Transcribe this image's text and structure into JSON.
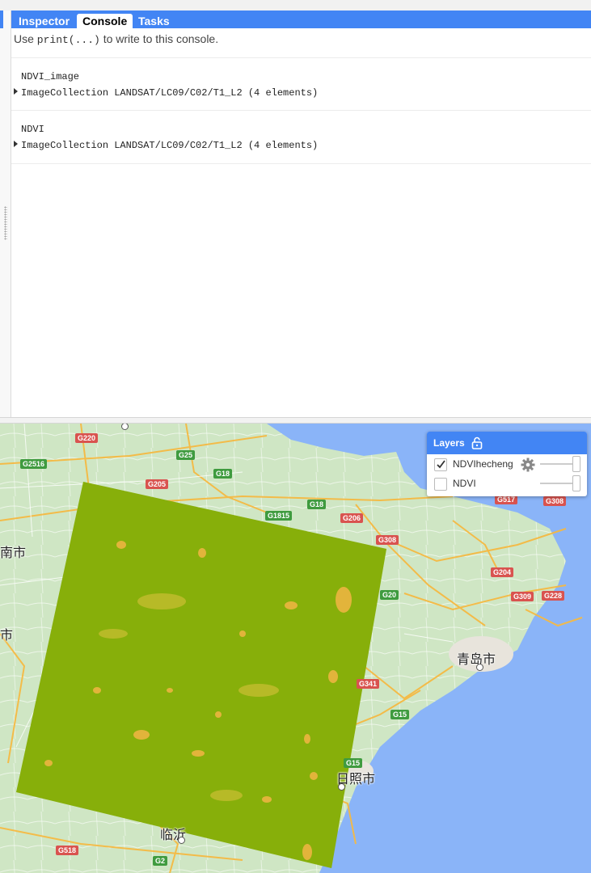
{
  "tabs": [
    {
      "label": "Inspector"
    },
    {
      "label": "Console"
    },
    {
      "label": "Tasks"
    }
  ],
  "console": {
    "hint_pre": "Use ",
    "hint_code": "print(...)",
    "hint_post": " to write to this console.",
    "entries": [
      {
        "title": "NDVI_image",
        "value": "ImageCollection LANDSAT/LC09/C02/T1_L2 (4 elements)"
      },
      {
        "title": "NDVI",
        "value": "ImageCollection LANDSAT/LC09/C02/T1_L2 (4 elements)"
      }
    ]
  },
  "map": {
    "shields": [
      {
        "text": "G220",
        "color": "red"
      },
      {
        "text": "G25",
        "color": "green"
      },
      {
        "text": "G2516",
        "color": "green"
      },
      {
        "text": "G18",
        "color": "green"
      },
      {
        "text": "G205",
        "color": "red"
      },
      {
        "text": "G18",
        "color": "green"
      },
      {
        "text": "G1815",
        "color": "green"
      },
      {
        "text": "G206",
        "color": "red"
      },
      {
        "text": "G308",
        "color": "red"
      },
      {
        "text": "G517",
        "color": "red"
      },
      {
        "text": "G308",
        "color": "red"
      },
      {
        "text": "G204",
        "color": "red"
      },
      {
        "text": "G20",
        "color": "green"
      },
      {
        "text": "G309",
        "color": "red"
      },
      {
        "text": "G228",
        "color": "red"
      },
      {
        "text": "G341",
        "color": "red"
      },
      {
        "text": "G15",
        "color": "green"
      },
      {
        "text": "G15",
        "color": "green"
      },
      {
        "text": "G518",
        "color": "red"
      },
      {
        "text": "G2",
        "color": "green"
      }
    ],
    "cities": [
      {
        "name": "青岛市"
      },
      {
        "name": "日照市"
      },
      {
        "name": "南市"
      },
      {
        "name": "市"
      },
      {
        "name": "临沂"
      }
    ],
    "overlay_color": "#8fb40a"
  },
  "layers": {
    "title": "Layers",
    "items": [
      {
        "name": "NDVIhecheng",
        "checked": true
      },
      {
        "name": "NDVI",
        "checked": false
      }
    ]
  },
  "colors": {
    "accent": "#4285f4",
    "sea": "#8ab4f8",
    "land": "#cfe6c4"
  }
}
